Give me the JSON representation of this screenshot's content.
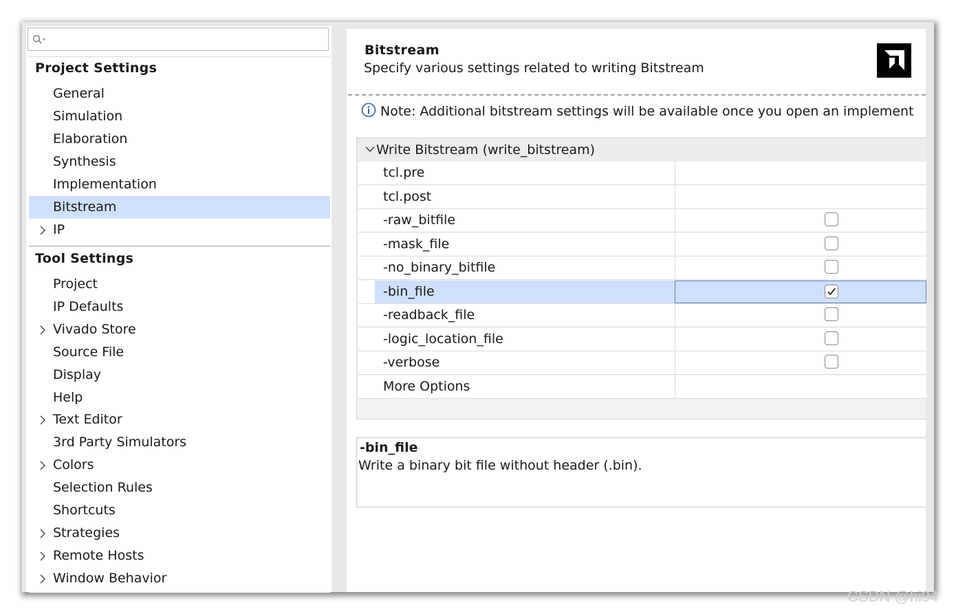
{
  "search": {
    "placeholder": ""
  },
  "left_tree": {
    "project_settings": {
      "header": "Project Settings",
      "items": [
        {
          "label": "General",
          "expandable": false,
          "selected": false
        },
        {
          "label": "Simulation",
          "expandable": false,
          "selected": false
        },
        {
          "label": "Elaboration",
          "expandable": false,
          "selected": false
        },
        {
          "label": "Synthesis",
          "expandable": false,
          "selected": false
        },
        {
          "label": "Implementation",
          "expandable": false,
          "selected": false
        },
        {
          "label": "Bitstream",
          "expandable": false,
          "selected": true
        },
        {
          "label": "IP",
          "expandable": true,
          "selected": false
        }
      ]
    },
    "tool_settings": {
      "header": "Tool Settings",
      "items": [
        {
          "label": "Project",
          "expandable": false
        },
        {
          "label": "IP Defaults",
          "expandable": false
        },
        {
          "label": "Vivado Store",
          "expandable": true
        },
        {
          "label": "Source File",
          "expandable": false
        },
        {
          "label": "Display",
          "expandable": false
        },
        {
          "label": "Help",
          "expandable": false
        },
        {
          "label": "Text Editor",
          "expandable": true
        },
        {
          "label": "3rd Party Simulators",
          "expandable": false
        },
        {
          "label": "Colors",
          "expandable": true
        },
        {
          "label": "Selection Rules",
          "expandable": false
        },
        {
          "label": "Shortcuts",
          "expandable": false
        },
        {
          "label": "Strategies",
          "expandable": true
        },
        {
          "label": "Remote Hosts",
          "expandable": true
        },
        {
          "label": "Window Behavior",
          "expandable": true
        }
      ]
    }
  },
  "main": {
    "title": "Bitstream",
    "subtitle": "Specify various settings related to writing Bitstream",
    "logo_icon": "amd-logo-icon",
    "note": "Note: Additional bitstream settings will be available once you open an implement",
    "group": {
      "label": "Write Bitstream (write_bitstream)",
      "expanded": true
    },
    "properties": [
      {
        "name": "tcl.pre",
        "type": "text",
        "value": ""
      },
      {
        "name": "tcl.post",
        "type": "text",
        "value": ""
      },
      {
        "name": "-raw_bitfile",
        "type": "checkbox",
        "checked": false
      },
      {
        "name": "-mask_file",
        "type": "checkbox",
        "checked": false
      },
      {
        "name": "-no_binary_bitfile",
        "type": "checkbox",
        "checked": false
      },
      {
        "name": "-bin_file",
        "type": "checkbox",
        "checked": true,
        "selected": true
      },
      {
        "name": "-readback_file",
        "type": "checkbox",
        "checked": false
      },
      {
        "name": "-logic_location_file",
        "type": "checkbox",
        "checked": false
      },
      {
        "name": "-verbose",
        "type": "checkbox",
        "checked": false
      },
      {
        "name": "More Options",
        "type": "text",
        "value": ""
      }
    ],
    "description": {
      "title": "-bin_file",
      "text": "Write a binary bit file without header (.bin)."
    }
  },
  "watermark": "CSDN @hi94",
  "colors": {
    "selection": "#cfe0fc",
    "selection_border": "#5a7fc0"
  }
}
